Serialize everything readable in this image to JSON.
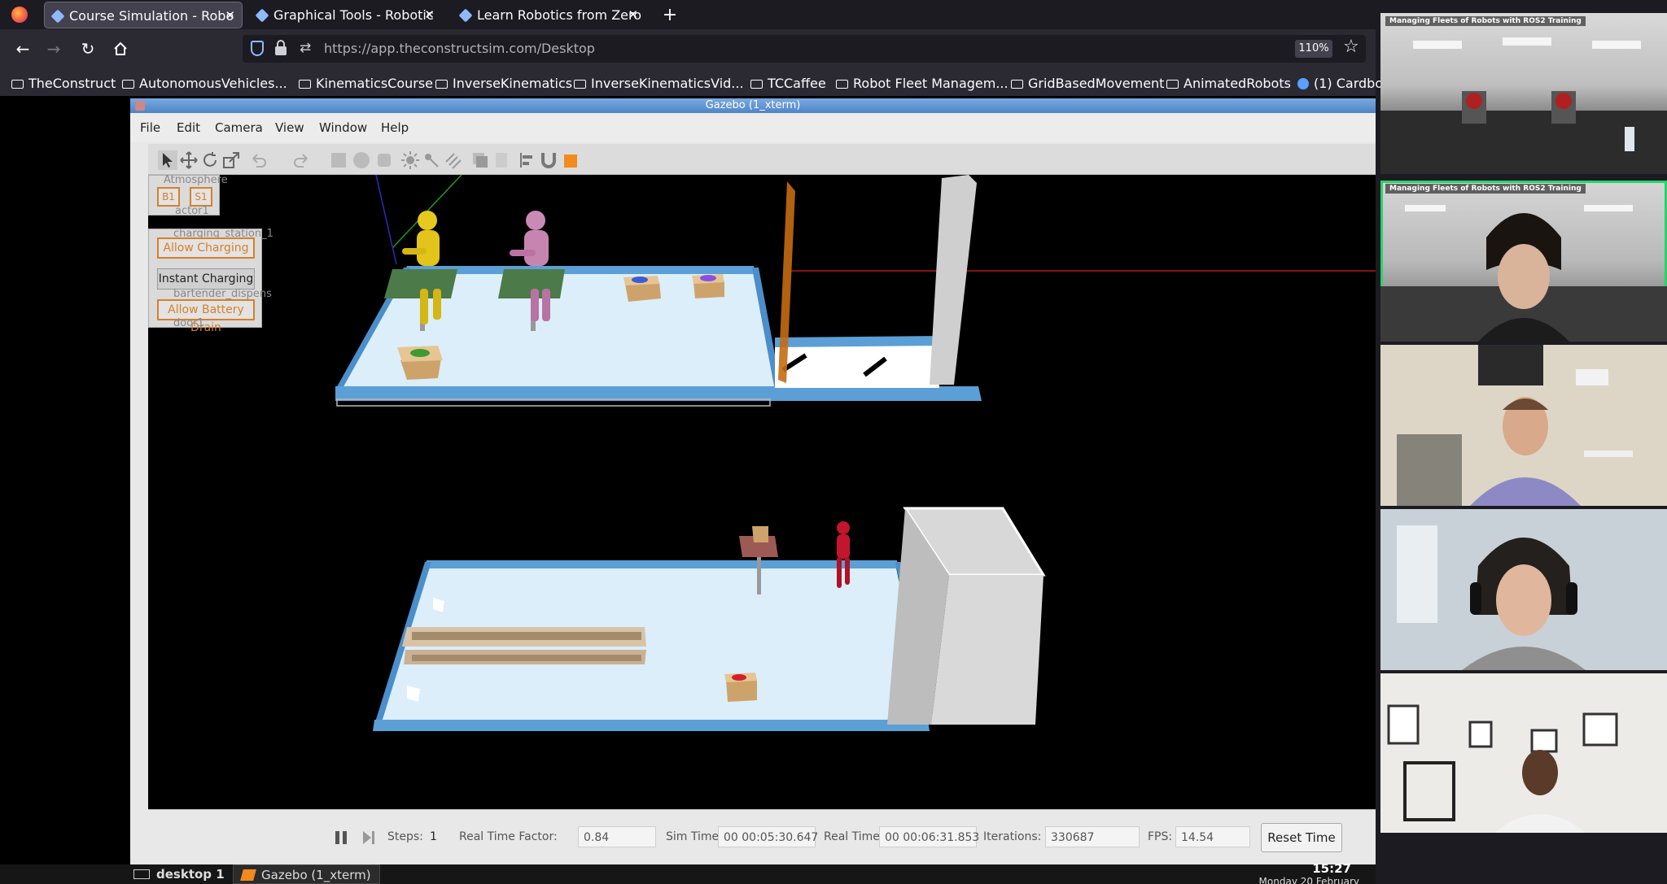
{
  "browser": {
    "tabs": [
      {
        "label": "Course Simulation - Robo",
        "active": true
      },
      {
        "label": "Graphical Tools - Robotic",
        "active": false
      },
      {
        "label": "Learn Robotics from Zero",
        "active": false
      }
    ],
    "url": "https://app.theconstructsim.com/Desktop",
    "zoom": "110%",
    "bookmarks": [
      {
        "label": "TheConstruct",
        "icon": "folder-icon"
      },
      {
        "label": "AutonomousVehicles...",
        "icon": "folder-icon"
      },
      {
        "label": "KinematicsCourse",
        "icon": "folder-icon"
      },
      {
        "label": "InverseKinematics",
        "icon": "folder-icon"
      },
      {
        "label": "InverseKinematicsVid...",
        "icon": "folder-icon"
      },
      {
        "label": "TCCaffee",
        "icon": "folder-icon"
      },
      {
        "label": "Robot Fleet Managem...",
        "icon": "folder-icon"
      },
      {
        "label": "GridBasedMovement",
        "icon": "folder-icon"
      },
      {
        "label": "AnimatedRobots",
        "icon": "folder-icon"
      },
      {
        "label": "(1) Cardbo",
        "icon": "globe-icon"
      }
    ]
  },
  "gazebo": {
    "window_title": "Gazebo (1_xterm)",
    "menu": [
      "File",
      "Edit",
      "Camera",
      "View",
      "Window",
      "Help"
    ],
    "overlay": {
      "atmosphere_label": "Atmosphere",
      "b1_label": "B1",
      "s1_label": "S1",
      "actor_label": "actor1",
      "charging_label": "charging_station_1",
      "bartender_label": "bartender_dispens",
      "door_label": "door1",
      "allow_charging": "Allow Charging",
      "instant_charging": "Instant Charging",
      "allow_battery_drain": "Allow Battery Drain"
    },
    "bottom": {
      "steps_label": "Steps:",
      "steps_value": "1",
      "rtf_label": "Real Time Factor:",
      "rtf_value": "0.84",
      "sim_time_label": "Sim Time:",
      "sim_time_value": "00 00:05:30.647",
      "real_time_label": "Real Time:",
      "real_time_value": "00 00:06:31.853",
      "iterations_label": "Iterations:",
      "iterations_value": "330687",
      "fps_label": "FPS:",
      "fps_value": "14.54",
      "reset_label": "Reset Time"
    }
  },
  "taskbar": {
    "desktop_label": "desktop 1",
    "app_label": "Gazebo (1_xterm)",
    "clock": "15:27",
    "date": "Monday 20 February"
  },
  "video_call": {
    "caption_1": "Managing Fleets of Robots with ROS2 Training",
    "caption_2": "Managing Fleets of Robots with ROS2 Training"
  },
  "colors": {
    "speaking_outline": "#27d36b",
    "gazebo_orange": "#d6802a",
    "floor": "#d8ebf8",
    "wall": "#5b9fd6"
  }
}
